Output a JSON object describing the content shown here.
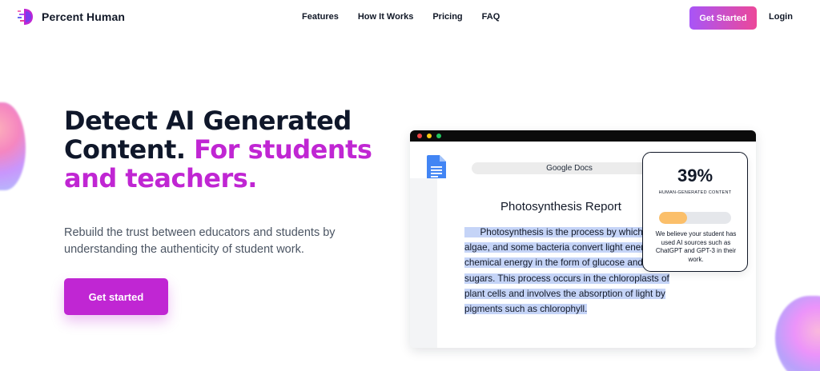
{
  "nav": {
    "brand": "Percent Human",
    "links": [
      "Features",
      "How It Works",
      "Pricing",
      "FAQ"
    ],
    "cta": "Get Started",
    "login": "Login"
  },
  "hero": {
    "title_line_1": "Detect AI Generated",
    "title_line_2a": "Content. ",
    "title_line_2b": "For students",
    "title_line_3": "and teachers.",
    "subtitle": "Rebuild the trust between educators and students by understanding the authenticity of student work.",
    "cta": "Get started"
  },
  "mock_doc": {
    "address": "Google Docs",
    "title": "Photosynthesis Report",
    "paragraph": "      Photosynthesis is the process by which plants, algae, and some bacteria convert light energy into chemical energy in the form of glucose and other sugars. This process occurs in the chloroplasts of plant cells and involves the absorption of light by pigments such as chlorophyll."
  },
  "score_card": {
    "value": "39%",
    "label": "HUMAN-GENERATED CONTENT",
    "fill_fraction": 0.39,
    "text": "We believe your student has used AI sources such as ChatGPT and GPT-3 in their work."
  },
  "colors": {
    "accent": "#c026d3",
    "gradient_start": "#a855f7",
    "gradient_end": "#ec4899",
    "score_fill": "#fbbf6a",
    "highlight": "#c5d4f7"
  }
}
